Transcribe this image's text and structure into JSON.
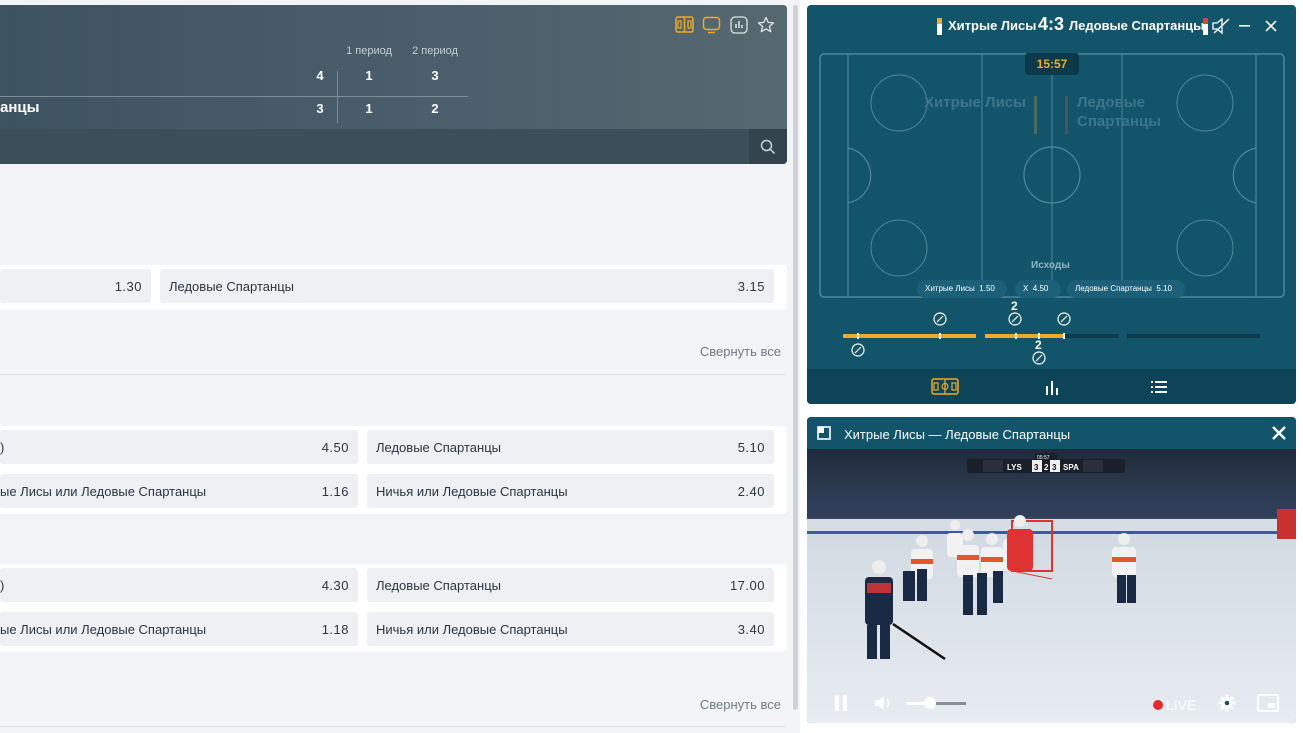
{
  "scoreboard": {
    "periods": [
      "1 период",
      "2 период"
    ],
    "team1": {
      "total": "4",
      "p1": "1",
      "p2": "3"
    },
    "team2": {
      "name_partial": "анцы",
      "total": "3",
      "p1": "1",
      "p2": "2"
    }
  },
  "markets": [
    {
      "rows": [
        {
          "left_label": "",
          "left_value": "1.30",
          "right_label": "Ледовые Спартанцы",
          "right_value": "3.15"
        }
      ],
      "collapse_label": "Свернуть все"
    },
    {
      "rows": [
        {
          "left_label": ")",
          "left_value": "4.50",
          "right_label": "Ледовые Спартанцы",
          "right_value": "5.10"
        },
        {
          "left_label": "ые Лисы или Ледовые Спартанцы",
          "left_value": "1.16",
          "right_label": "Ничья или Ледовые Спартанцы",
          "right_value": "2.40"
        }
      ]
    },
    {
      "rows": [
        {
          "left_label": ")",
          "left_value": "4.30",
          "right_label": "Ледовые Спартанцы",
          "right_value": "17.00"
        },
        {
          "left_label": "ые Лисы или Ледовые Спартанцы",
          "left_value": "1.18",
          "right_label": "Ничья или Ледовые Спартанцы",
          "right_value": "3.40"
        }
      ],
      "collapse_label": "Свернуть все"
    }
  ],
  "widget": {
    "team1": "Хитрые Лисы",
    "team2": "Ледовые Спартанцы",
    "score": "4:3",
    "timer": "15:57",
    "field_team1": "Хитрые Лисы",
    "field_team2_line1": "Ледовые",
    "field_team2_line2": "Спартанцы",
    "outcomes_title": "Исходы",
    "outcomes": [
      {
        "label": "Хитрые Лисы",
        "value": "1.50"
      },
      {
        "label": "X",
        "value": "4.50"
      },
      {
        "label": "Ледовые Спартанцы",
        "value": "5.10"
      }
    ],
    "bar_label_top": "2",
    "bar_label_bottom": "2",
    "tabs": [
      "field-icon",
      "stats-icon",
      "list-icon"
    ],
    "colors": {
      "accent": "#f0a928",
      "bg": "#12556b"
    }
  },
  "video": {
    "title": "Хитрые Лисы — Ледовые Спартанцы",
    "live_label": "LIVE",
    "scorebug": {
      "team1": "LYS",
      "score1": "3",
      "score2": "3",
      "team2": "SPA",
      "period": "2",
      "clock": "05:57"
    },
    "volume": 0.4
  }
}
